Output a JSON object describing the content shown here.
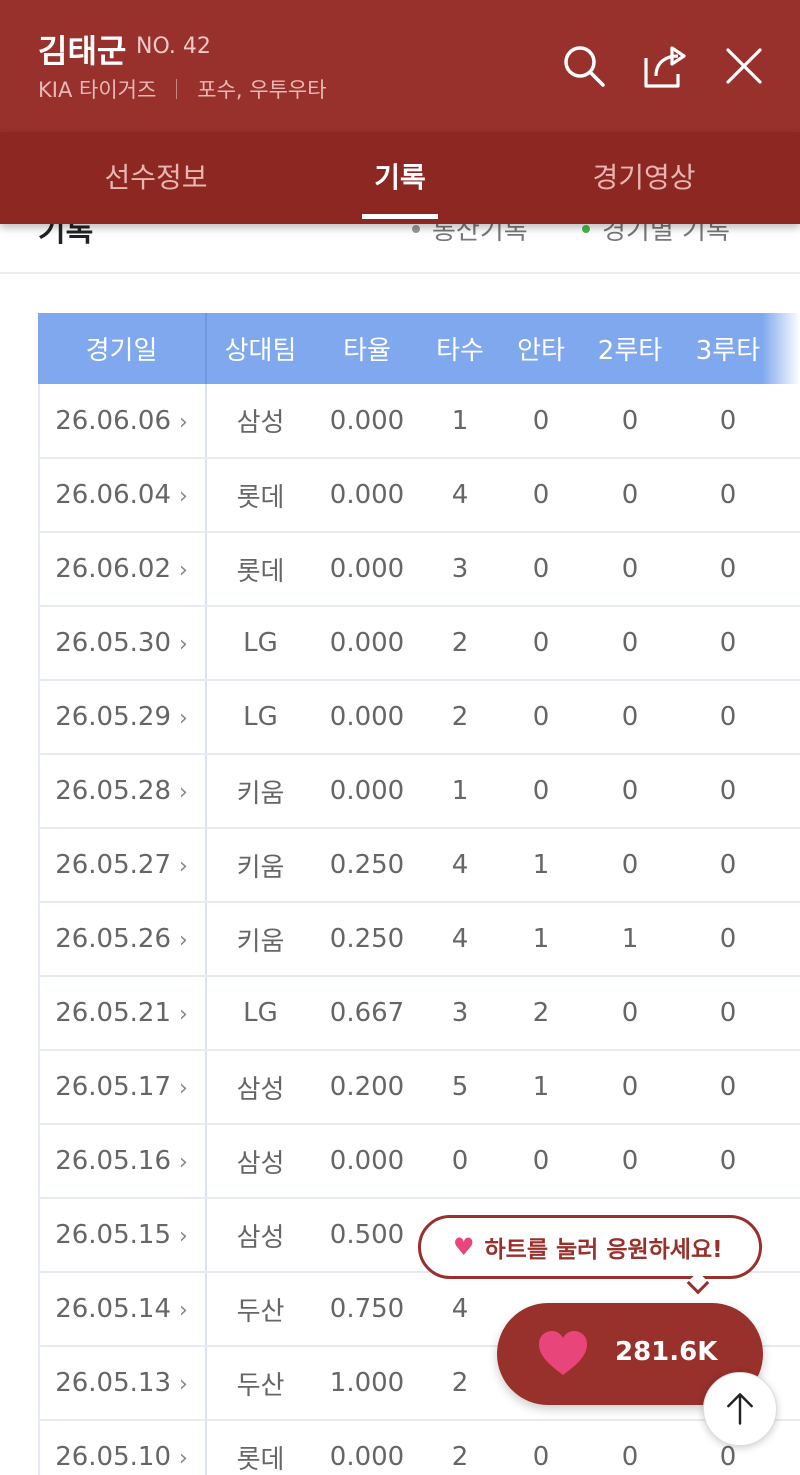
{
  "player": {
    "name": "김태군",
    "number": "NO. 42",
    "team": "KIA 타이거즈",
    "position": "포수, 우투우타"
  },
  "header_icons": [
    "search-icon",
    "share-icon",
    "close-icon"
  ],
  "tabs": [
    {
      "label": "선수정보",
      "active": false
    },
    {
      "label": "기록",
      "active": true
    },
    {
      "label": "경기영상",
      "active": false
    }
  ],
  "section": {
    "title": "기록",
    "legend_total": "통산기록",
    "legend_game": "경기별 기록"
  },
  "table": {
    "headers": [
      "경기일",
      "상대팀",
      "타율",
      "타수",
      "안타",
      "2루타",
      "3루타"
    ],
    "rows": [
      [
        "26.06.06",
        "삼성",
        "0.000",
        "1",
        "0",
        "0",
        "0"
      ],
      [
        "26.06.04",
        "롯데",
        "0.000",
        "4",
        "0",
        "0",
        "0"
      ],
      [
        "26.06.02",
        "롯데",
        "0.000",
        "3",
        "0",
        "0",
        "0"
      ],
      [
        "26.05.30",
        "LG",
        "0.000",
        "2",
        "0",
        "0",
        "0"
      ],
      [
        "26.05.29",
        "LG",
        "0.000",
        "2",
        "0",
        "0",
        "0"
      ],
      [
        "26.05.28",
        "키움",
        "0.000",
        "1",
        "0",
        "0",
        "0"
      ],
      [
        "26.05.27",
        "키움",
        "0.250",
        "4",
        "1",
        "0",
        "0"
      ],
      [
        "26.05.26",
        "키움",
        "0.250",
        "4",
        "1",
        "1",
        "0"
      ],
      [
        "26.05.21",
        "LG",
        "0.667",
        "3",
        "2",
        "0",
        "0"
      ],
      [
        "26.05.17",
        "삼성",
        "0.200",
        "5",
        "1",
        "0",
        "0"
      ],
      [
        "26.05.16",
        "삼성",
        "0.000",
        "0",
        "0",
        "0",
        "0"
      ],
      [
        "26.05.15",
        "삼성",
        "0.500",
        "",
        "",
        "",
        ""
      ],
      [
        "26.05.14",
        "두산",
        "0.750",
        "4",
        "",
        "",
        ""
      ],
      [
        "26.05.13",
        "두산",
        "1.000",
        "2",
        "",
        "",
        ""
      ],
      [
        "26.05.10",
        "롯데",
        "0.000",
        "2",
        "0",
        "0",
        "0"
      ]
    ]
  },
  "cheer": {
    "bubble_text": "하트를 눌러 응원하세요!",
    "heart_count": "281.6K"
  },
  "colors": {
    "header_bg": "#98302b",
    "tab_bg": "#8c2722",
    "table_header_bg": "#7fa8ee",
    "heart": "#e8457a"
  }
}
